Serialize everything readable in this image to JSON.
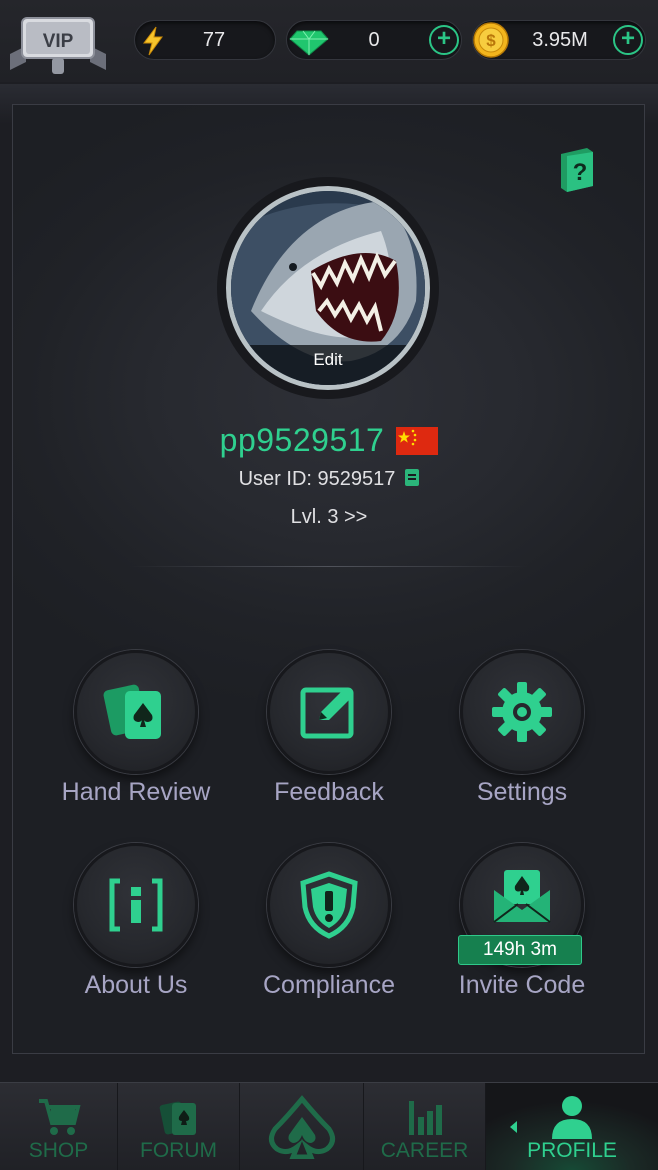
{
  "header": {
    "vip_label": "VIP",
    "energy": {
      "icon": "lightning-icon",
      "value": "77"
    },
    "gems": {
      "icon": "diamond-icon",
      "value": "0",
      "add_icon": "plus-icon"
    },
    "coins": {
      "icon": "coin-icon",
      "value": "3.95M",
      "add_icon": "plus-icon"
    }
  },
  "profile": {
    "avatar_edit_label": "Edit",
    "username": "pp9529517",
    "country_flag": "china-flag-icon",
    "user_id_text": "User ID: 9529517",
    "level_text": "Lvl. 3 >>"
  },
  "menu": [
    {
      "label": "Hand Review",
      "icon": "cards-icon"
    },
    {
      "label": "Feedback",
      "icon": "edit-note-icon"
    },
    {
      "label": "Settings",
      "icon": "gear-icon"
    },
    {
      "label": "About Us",
      "icon": "info-icon"
    },
    {
      "label": "Compliance",
      "icon": "shield-alert-icon"
    },
    {
      "label": "Invite Code",
      "icon": "envelope-spade-icon",
      "timer": "149h  3m"
    }
  ],
  "nav": [
    {
      "label": "SHOP",
      "icon": "cart-icon"
    },
    {
      "label": "FORUM",
      "icon": "cards-icon"
    },
    {
      "label": "",
      "icon": "spade-logo-icon"
    },
    {
      "label": "CAREER",
      "icon": "bar-chart-icon"
    },
    {
      "label": "PROFILE",
      "icon": "user-icon",
      "active": true
    }
  ],
  "colors": {
    "accent": "#2fd08f",
    "label": "#a7a5c4",
    "background": "#1d1e23"
  }
}
